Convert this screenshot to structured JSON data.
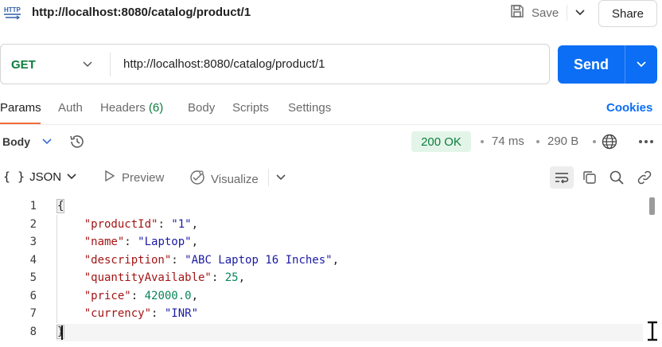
{
  "header": {
    "title": "http://localhost:8080/catalog/product/1",
    "icon_label": "HTTP",
    "save_label": "Save",
    "share_label": "Share"
  },
  "request": {
    "method": "GET",
    "url": "http://localhost:8080/catalog/product/1",
    "send_label": "Send"
  },
  "tabs": [
    {
      "label": "Params",
      "active": true
    },
    {
      "label": "Auth"
    },
    {
      "label": "Headers",
      "count": "(6)"
    },
    {
      "label": "Body"
    },
    {
      "label": "Scripts"
    },
    {
      "label": "Settings"
    }
  ],
  "cookies_label": "Cookies",
  "response": {
    "body_label": "Body",
    "status": "200 OK",
    "time": "74 ms",
    "size": "290 B",
    "format": "JSON",
    "preview_label": "Preview",
    "visualize_label": "Visualize",
    "lines": [
      {
        "n": "1",
        "text": "{"
      },
      {
        "n": "2",
        "key": "\"productId\"",
        "sep": ": ",
        "val": "\"1\"",
        "type": "str",
        "end": ","
      },
      {
        "n": "3",
        "key": "\"name\"",
        "sep": ": ",
        "val": "\"Laptop\"",
        "type": "str",
        "end": ","
      },
      {
        "n": "4",
        "key": "\"description\"",
        "sep": ": ",
        "val": "\"ABC Laptop 16 Inches\"",
        "type": "str",
        "end": ","
      },
      {
        "n": "5",
        "key": "\"quantityAvailable\"",
        "sep": ": ",
        "val": "25",
        "type": "num",
        "end": ","
      },
      {
        "n": "6",
        "key": "\"price\"",
        "sep": ": ",
        "val": "42000.0",
        "type": "num",
        "end": ","
      },
      {
        "n": "7",
        "key": "\"currency\"",
        "sep": ": ",
        "val": "\"INR\"",
        "type": "str",
        "end": ""
      },
      {
        "n": "8",
        "text": "}"
      }
    ]
  },
  "colors": {
    "accent": "#0b6ef5",
    "status_bg": "#e3f5e8",
    "status_text": "#0b7d3e",
    "tab_underline": "#f26b3a"
  }
}
